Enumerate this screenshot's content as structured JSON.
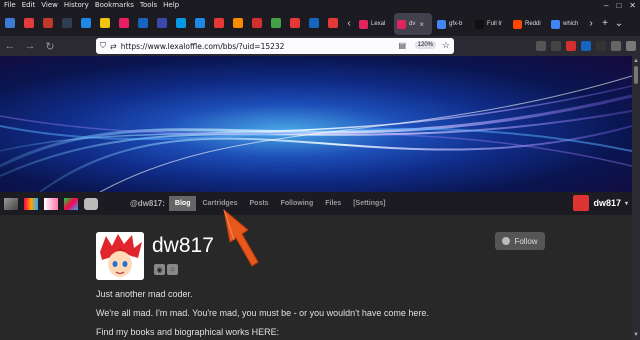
{
  "menu": {
    "items": [
      "File",
      "Edit",
      "View",
      "History",
      "Bookmarks",
      "Tools",
      "Help"
    ]
  },
  "tabs": {
    "pinned_colors": [
      "#3a7bd5",
      "#e23c3c",
      "#c0392b",
      "#2c3e50",
      "#1e88e5",
      "#f1c40f",
      "#e91e63",
      "#1565c0",
      "#3949ab",
      "#039be5",
      "#1e88e5",
      "#e53935",
      "#fb8c00",
      "#d32f2f",
      "#43a047",
      "#e53935",
      "#1565c0",
      "#e53935"
    ],
    "open": [
      {
        "label": "Lexal",
        "color": "#e0245e",
        "active": false
      },
      {
        "label": "dv",
        "color": "#e0245e",
        "active": true,
        "close": "×"
      },
      {
        "label": "gfx-b",
        "color": "#4285f4",
        "active": false
      },
      {
        "label": "Full Ir",
        "color": "#111111",
        "active": false
      },
      {
        "label": "Reddi",
        "color": "#ff4500",
        "active": false
      },
      {
        "label": "which",
        "color": "#4285f4",
        "active": false
      }
    ],
    "scroll_left": "‹",
    "scroll_right": "›",
    "new_tab": "+",
    "list": "⌄"
  },
  "nav": {
    "back": "←",
    "forward": "→",
    "reload": "↻",
    "url": "https://www.lexaloffle.com/bbs/?uid=15232",
    "zoom": "120%",
    "star": "☆"
  },
  "bbs": {
    "handle": "@dw817:",
    "links": [
      {
        "label": "Blog",
        "active": true
      },
      {
        "label": "Cartridges",
        "active": false
      },
      {
        "label": "Posts",
        "active": false
      },
      {
        "label": "Following",
        "active": false
      },
      {
        "label": "Files",
        "active": false
      },
      {
        "label": "[Settings]",
        "active": false
      }
    ],
    "user": "dw817",
    "caret": "▾"
  },
  "profile": {
    "name": "dw817",
    "follow_label": "Follow",
    "paragraphs": [
      "Just another mad coder.",
      "We're all mad. I'm mad. You're mad, you must be - or you wouldn't have come here.",
      "Find my books and biographical works HERE:"
    ]
  },
  "colors": {
    "banner_glow": "#4aa8e8",
    "annotation_arrow": "#e8581c"
  }
}
